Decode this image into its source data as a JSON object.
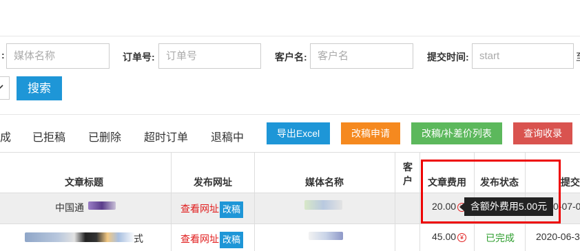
{
  "filters": {
    "media_name_placeholder": "媒体名称",
    "order_label": "订单号:",
    "order_placeholder": "订单号",
    "customer_label": "客户名:",
    "customer_placeholder": "客户名",
    "submit_time_label": "提交时间:",
    "submit_time_placeholder": "start",
    "search_button": "搜索"
  },
  "tabs": [
    "成",
    "已拒稿",
    "已删除",
    "超时订单",
    "退稿中"
  ],
  "actions": {
    "export_excel": "导出Excel",
    "revise_request": "改稿申请",
    "revise_list": "改稿/补差价列表",
    "view_receipt": "查询收录"
  },
  "colors": {
    "primary": "#1e96d7",
    "export": "#1e96d7",
    "revise": "#f5891f",
    "revise_list": "#5cb85c",
    "receipt": "#d9534f",
    "link_red": "#e11e1e",
    "status_done": "#2e9e2e",
    "highlight": "#ee0000"
  },
  "table": {
    "headers": {
      "title": "文章标题",
      "url": "发布网址",
      "media": "媒体名称",
      "customer": "客户",
      "fee": "文章费用",
      "status": "发布状态",
      "submit": "提交"
    },
    "rows": [
      {
        "title": "中国通",
        "view_link": "查看网址",
        "revise_btn": "改稿",
        "fee": "20.00",
        "status": "",
        "submit": "0-07-0"
      },
      {
        "title": "式",
        "view_link": "查看网址",
        "revise_btn": "改稿",
        "fee": "45.00",
        "status": "已完成",
        "submit": "2020-06-3"
      }
    ]
  },
  "tooltip": "含额外费用5.00元",
  "currency_symbol": "¥"
}
